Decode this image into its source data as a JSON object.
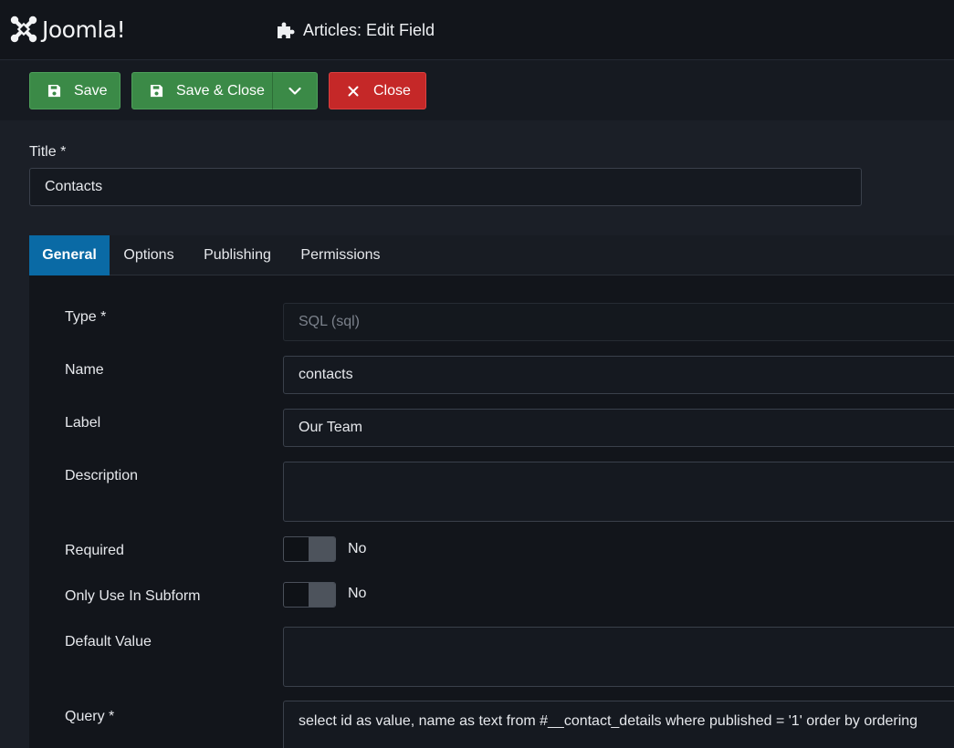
{
  "header": {
    "logo_text": "Joomla!",
    "page_title": "Articles: Edit Field"
  },
  "toolbar": {
    "save_label": "Save",
    "save_close_label": "Save & Close",
    "close_label": "Close"
  },
  "title_field": {
    "label": "Title *",
    "value": "Contacts"
  },
  "tabs": [
    {
      "label": "General",
      "active": true
    },
    {
      "label": "Options",
      "active": false
    },
    {
      "label": "Publishing",
      "active": false
    },
    {
      "label": "Permissions",
      "active": false
    }
  ],
  "general": {
    "type": {
      "label": "Type *",
      "value": "SQL (sql)"
    },
    "name": {
      "label": "Name",
      "value": "contacts"
    },
    "label_field": {
      "label": "Label",
      "value": "Our Team"
    },
    "description": {
      "label": "Description",
      "value": ""
    },
    "required": {
      "label": "Required",
      "state": "No"
    },
    "only_subform": {
      "label": "Only Use In Subform",
      "state": "No"
    },
    "default_value": {
      "label": "Default Value",
      "value": ""
    },
    "query": {
      "label": "Query *",
      "value": "select id as value, name as text from #__contact_details where published = '1' order by ordering"
    }
  },
  "colors": {
    "accent": "#0a6aa5",
    "success": "#3b8a47",
    "danger": "#c52828"
  }
}
